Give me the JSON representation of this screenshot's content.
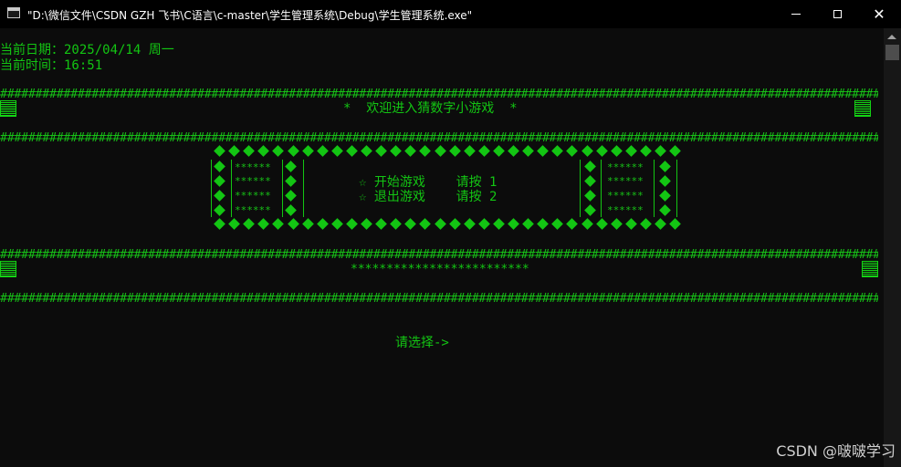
{
  "window": {
    "title": "\"D:\\微信文件\\CSDN GZH 飞书\\C语言\\c-master\\学生管理系统\\Debug\\学生管理系统.exe\"",
    "controls": {
      "minimize": "minimize-icon",
      "maximize": "maximize-icon",
      "close": "✕"
    }
  },
  "console": {
    "date_line": "当前日期：2025/04/14 周一",
    "time_line": "当前时间：16:51",
    "hash_row": "###############################################################################################################################",
    "welcome": "*  欢迎进入猜数字小游戏  *",
    "menu": {
      "option1": "☆ 开始游戏    请按 1",
      "option2": "☆ 退出游戏    请按 2",
      "stars_cell": "******"
    },
    "stars_banner": "*************************",
    "prompt": "请选择->"
  },
  "watermark": "CSDN @啵啵学习",
  "colors": {
    "text": "#13c513",
    "background": "#0c0c0c",
    "titlebar": "#000000"
  }
}
